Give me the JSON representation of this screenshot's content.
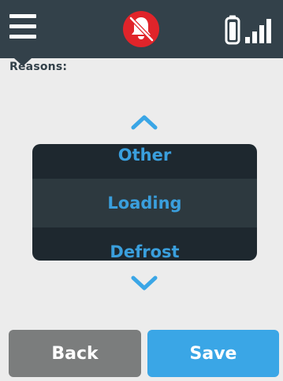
{
  "header": {
    "menu_icon": "hamburger-menu-icon",
    "alarm_icon": "alarm-muted-icon",
    "battery_icon": "battery-icon",
    "signal_icon": "signal-strength-icon"
  },
  "content": {
    "reasons_label": "Reasons:"
  },
  "picker": {
    "prev_option": "Other",
    "selected_option": "Loading",
    "next_option": "Defrost",
    "up_icon": "chevron-up-icon",
    "down_icon": "chevron-down-icon"
  },
  "footer": {
    "back_label": "Back",
    "save_label": "Save"
  },
  "colors": {
    "header_bg": "#33414a",
    "picker_bg": "#1e282f",
    "picker_selected_bg": "#2d393f",
    "accent": "#3aa6e6",
    "alarm_red": "#e0242a",
    "back_button": "#7b7d7d",
    "page_bg": "#ececec"
  }
}
